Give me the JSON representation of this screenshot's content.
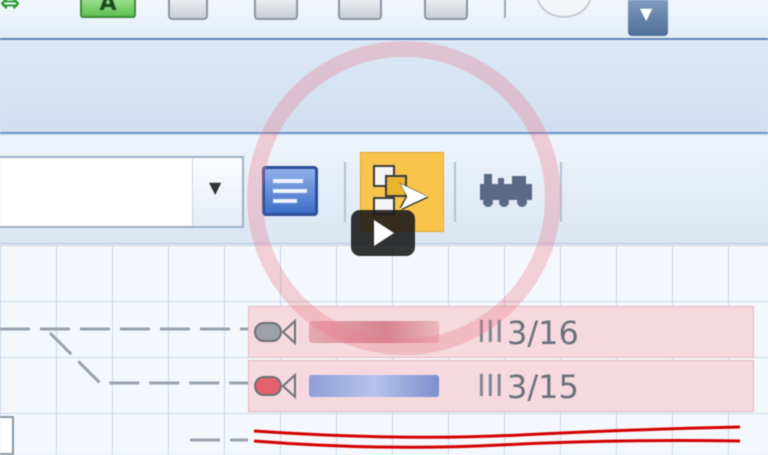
{
  "top_toolbar": {
    "a_button_label": "A",
    "icons": [
      "green-double-arrow-icon",
      "text-a-icon",
      "window-icon",
      "copy-icon",
      "edit-document-icon",
      "paste-icon",
      "clock-icon",
      "toolbar-overflow-icon"
    ]
  },
  "toolbar": {
    "icons": [
      "panel-list-icon",
      "select-copy-cursor-icon",
      "train-icon"
    ],
    "active_tool": "select-copy-cursor-icon",
    "active_color": "#f8c44a"
  },
  "train_rows": [
    {
      "roman": "III",
      "value": "3/16",
      "indicator_color": "#9ea2a8"
    },
    {
      "roman": "III",
      "value": "3/15",
      "indicator_color": "#e4626e"
    }
  ],
  "colors": {
    "highlight_ring": "#ec788a",
    "row_background": "#f5d9df",
    "track_red": "#d40000",
    "toolbar_border": "#5f86b6"
  },
  "overlay": {
    "play_icon": "play-icon",
    "ring": "highlight-ring"
  }
}
